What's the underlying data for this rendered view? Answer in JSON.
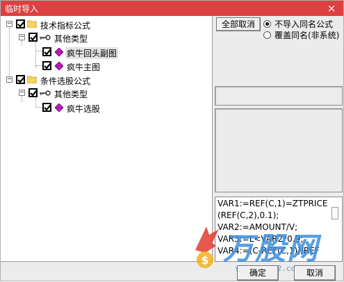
{
  "window": {
    "title": "临时导入",
    "close_glyph": "×"
  },
  "tree": {
    "nodes": [
      {
        "id": "indicator",
        "toggle": "−",
        "checked": true,
        "icon": "folder-icon",
        "label": "技术指标公式"
      },
      {
        "id": "indicator-other",
        "toggle": "−",
        "checked": true,
        "icon": "key-icon",
        "label": "其他类型"
      },
      {
        "id": "indicator-item-1",
        "checked": true,
        "icon": "formula-gem-icon",
        "label": "疯牛回头副图",
        "selected": true
      },
      {
        "id": "indicator-item-2",
        "checked": true,
        "icon": "formula-gem-icon",
        "label": "疯牛主图"
      },
      {
        "id": "selection",
        "toggle": "−",
        "checked": true,
        "icon": "folder-icon",
        "label": "条件选股公式"
      },
      {
        "id": "selection-other",
        "toggle": "−",
        "checked": true,
        "icon": "key-icon",
        "label": "其他类型"
      },
      {
        "id": "selection-item-1",
        "checked": true,
        "icon": "formula-gem-icon",
        "label": "疯牛选股"
      }
    ]
  },
  "options": {
    "cancel_all_label": "全部取消",
    "radio_no_import": "不导入同名公式",
    "radio_overwrite": "覆盖同名(非系统)",
    "selected_radio": "no_import"
  },
  "code_preview": {
    "lines": [
      "VAR1:=REF(C,1)=ZTPRICE",
      "(REF(C,2),0.1);",
      "VAR2:=AMOUNT/V;",
      "VAR3:=L<VAR2*0.9;",
      "VAR4:=(C-REF(C,1))/REF"
    ]
  },
  "watermark": {
    "text": "万股网",
    "url": "www.201082.com"
  },
  "footer": {
    "ok_label": "确定",
    "cancel_label": "取消"
  },
  "colors": {
    "titlebar": "#dd4040",
    "selection_bg": "#e3e3e3",
    "gem": "#c020c0",
    "folder": "#f4d35e"
  }
}
